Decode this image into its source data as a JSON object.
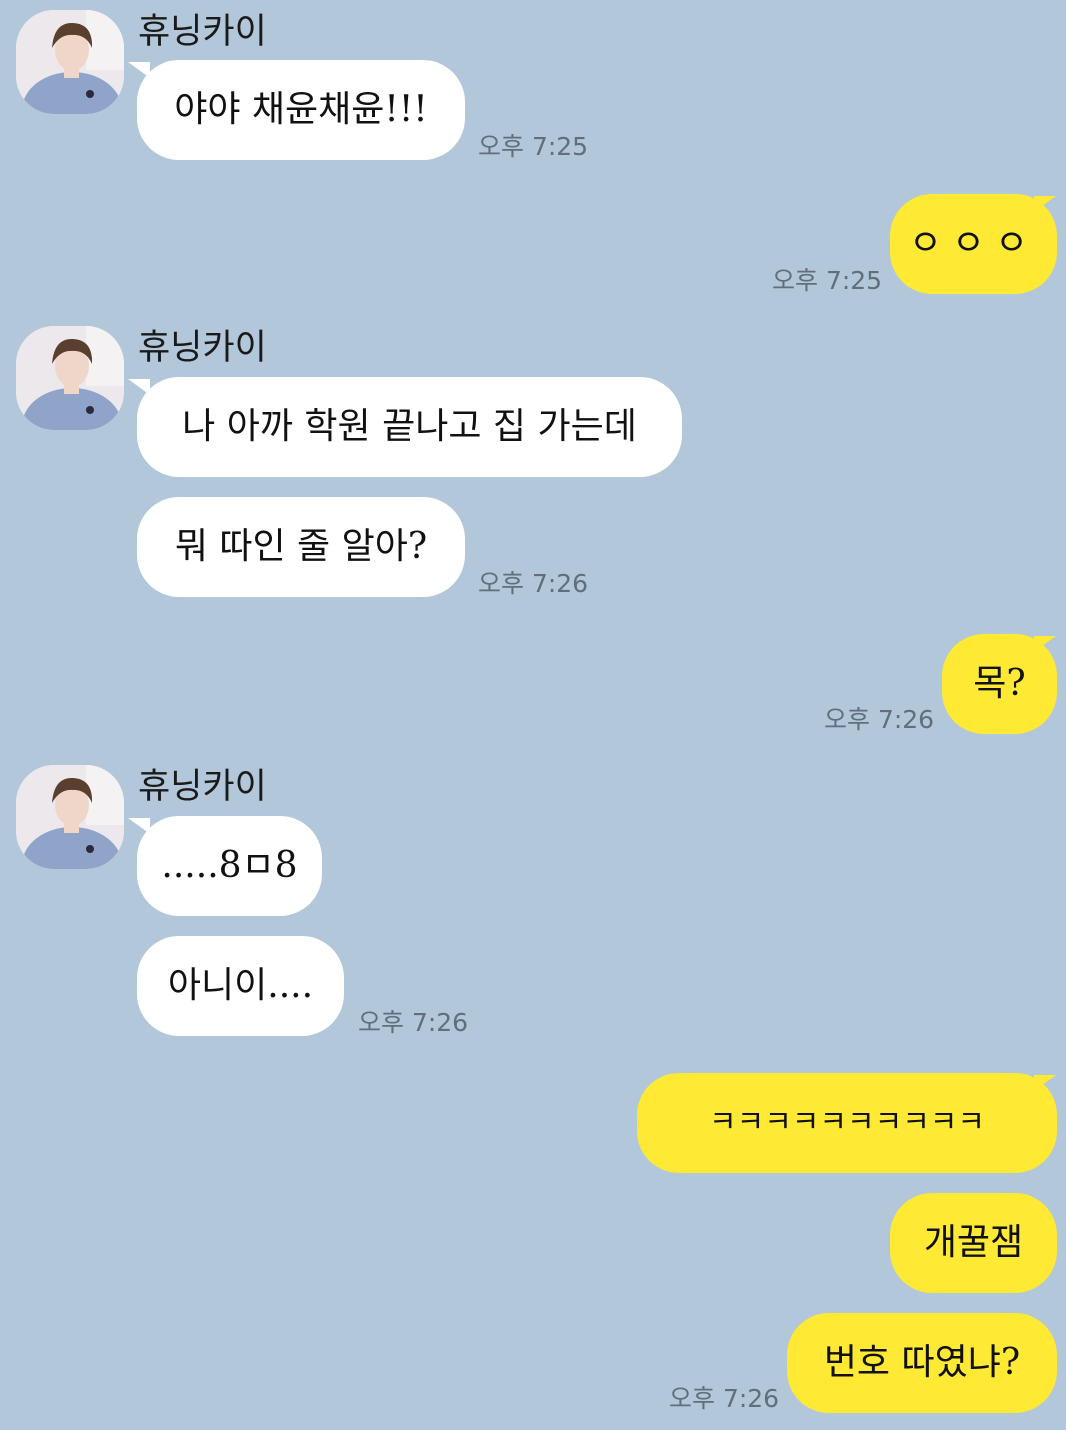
{
  "contact": {
    "name": "휴닝카이",
    "avatar_icon": "profile-photo"
  },
  "colors": {
    "background": "#b2c7da",
    "incoming_bubble": "#ffffff",
    "outgoing_bubble": "#fee934"
  },
  "messages": [
    {
      "from": "contact",
      "text": "야야 채윤채윤!!!",
      "time": "오후 7:25"
    },
    {
      "from": "me",
      "text": "ㅇㅇㅇ",
      "time": "오후 7:25"
    },
    {
      "from": "contact",
      "text": "나 아까 학원 끝나고 집 가는데",
      "time": ""
    },
    {
      "from": "contact",
      "text": "뭐 따인 줄 알아?",
      "time": "오후 7:26"
    },
    {
      "from": "me",
      "text": "목?",
      "time": "오후 7:26"
    },
    {
      "from": "contact",
      "text": ".....8ㅁ8",
      "time": ""
    },
    {
      "from": "contact",
      "text": "아니이....",
      "time": "오후 7:26"
    },
    {
      "from": "me",
      "text": "ㅋㅋㅋㅋㅋㅋㅋㅋㅋㅋ",
      "time": ""
    },
    {
      "from": "me",
      "text": "개꿀잼",
      "time": ""
    },
    {
      "from": "me",
      "text": "번호 따였냐?",
      "time": "오후 7:26"
    }
  ]
}
